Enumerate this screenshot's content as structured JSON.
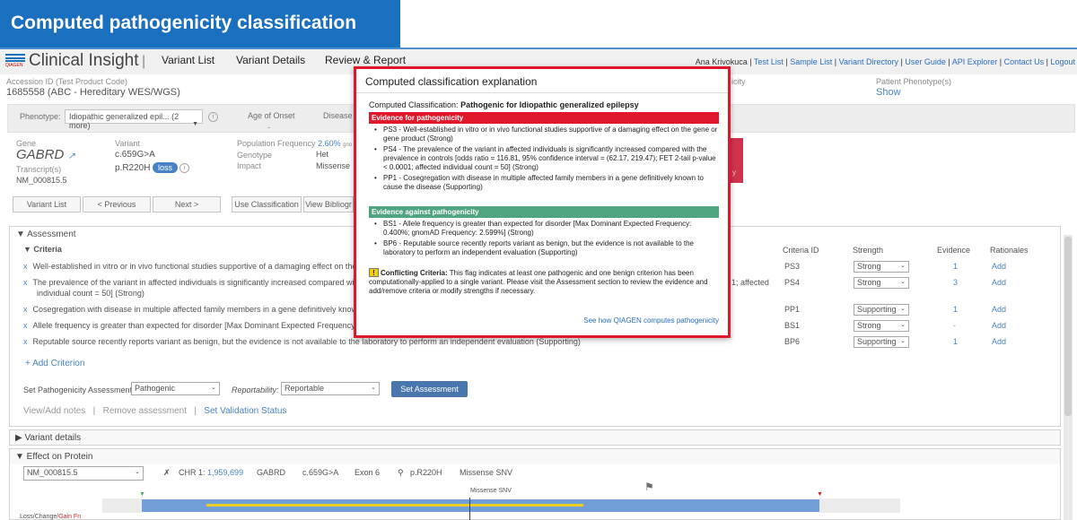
{
  "banner": {
    "title": "Computed pathogenicity classification"
  },
  "app": {
    "brand_prefix": "QIAGEN",
    "brand": "Clinical Insight",
    "separator": "|",
    "nav": [
      "Variant List",
      "Variant Details",
      "Review & Report"
    ],
    "user_links": [
      "Ana Krivokuca",
      "Test List",
      "Sample List",
      "Variant Directory",
      "User Guide",
      "API Explorer",
      "Contact Us",
      "Logout"
    ]
  },
  "accession": {
    "label": "Accession ID (Test Product Code)",
    "value": "1685558  (ABC - Hereditary WES/WGS)"
  },
  "patient_phenotype": {
    "label": "Patient Phenotype(s)",
    "value": "Show",
    "left_fragment": "icity"
  },
  "phenotype_row": {
    "label": "Phenotype:",
    "select_value": "Idiopathic generalized epil... (2 more)",
    "age_label": "Age of Onset",
    "age_value": "-",
    "disease_label": "Disease"
  },
  "gene_area": {
    "gene_label": "Gene",
    "gene": "GABRD",
    "transcript_label": "Transcript(s)",
    "transcript": "NM_000815.5",
    "variant_label": "Variant",
    "variant_c": "c.659G>A",
    "variant_p": "p.R220H",
    "loss_badge": "loss",
    "pop_freq_label": "Population Frequency",
    "pop_freq_value": "2.60%",
    "pop_freq_suffix": "gno",
    "genotype_label": "Genotype",
    "genotype_value": "Het",
    "impact_label": "Impact",
    "impact_value": "Missense",
    "red_box_text": "y"
  },
  "buttons": {
    "variant_list": "Variant List",
    "previous": "< Previous",
    "next": "Next >",
    "use_classification": "Use Classification",
    "view_biblio": "View Bibliogr"
  },
  "assessment": {
    "header": "▼ Assessment",
    "criteria_header": "▼ Criteria",
    "columns": {
      "criteria_id": "Criteria ID",
      "strength": "Strength",
      "evidence": "Evidence",
      "rationales": "Rationales"
    },
    "rows": [
      {
        "text": "Well-established in vitro or in vivo functional studies supportive of a damaging effect on the gen",
        "id": "PS3",
        "strength": "Strong",
        "evidence": "1",
        "rationale": "Add"
      },
      {
        "text": "The prevalence of the variant in affected individuals is significantly increased compared with th",
        "text2": "individual count = 50] (Strong)",
        "tail": "1; affected",
        "id": "PS4",
        "strength": "Strong",
        "evidence": "3",
        "rationale": "Add"
      },
      {
        "text": "Cosegregation with disease in multiple affected family members in a gene definitively known to",
        "id": "PP1",
        "strength": "Supporting",
        "evidence": "1",
        "rationale": "Add"
      },
      {
        "text": "Allele frequency is greater than expected for disorder [Max Dominant Expected Frequency: 0.4",
        "id": "BS1",
        "strength": "Strong",
        "evidence": "-",
        "rationale": "Add"
      },
      {
        "text": "Reputable source recently reports variant as benign, but the evidence is not available to the laboratory to perform an independent evaluation (Supporting)",
        "id": "BP6",
        "strength": "Supporting",
        "evidence": "1",
        "rationale": "Add"
      }
    ],
    "add_criterion": "+ Add Criterion",
    "set_path_label": "Set Pathogenicity Assessment:",
    "set_path_value": "Pathogenic",
    "reportability_label": "Reportability:",
    "reportability_value": "Reportable",
    "set_assessment_button": "Set Assessment",
    "view_add_notes": "View/Add notes",
    "remove_assessment": "Remove assessment",
    "link_separator": "|",
    "set_validation": "Set Validation Status"
  },
  "variant_details": {
    "header": "▶ Variant details"
  },
  "effect": {
    "header": "▼ Effect on Protein",
    "transcript": "NM_000815.5",
    "chr_label": "CHR 1:",
    "chr_pos": "1,959,699",
    "gene": "GABRD",
    "cdna": "c.659G>A",
    "exon": "Exon 6",
    "protein": "p.R220H",
    "type": "Missense SNV",
    "marker_label": "Missense SNV",
    "bottom_label": "Loss/Change/",
    "bottom_link": "Gain Fn"
  },
  "modal": {
    "title": "Computed classification explanation",
    "computed_label": "Computed Classification:",
    "computed_value": "Pathogenic for Idiopathic generalized epilepsy",
    "evidence_for_header": "Evidence for pathogenicity",
    "evidence_for": [
      "PS3 - Well-established in vitro or in vivo functional studies supportive of a damaging effect on the gene or gene product (Strong)",
      "PS4 - The prevalence of the variant in affected individuals is significantly increased compared with the prevalence in controls [odds ratio = 116.81, 95% confidence interval = (62.17, 219.47); FET 2-tail p-value < 0.0001; affected individual count = 50] (Strong)",
      "PP1 - Cosegregation with disease in multiple affected family members in a gene definitively known to cause the disease (Supporting)"
    ],
    "evidence_against_header": "Evidence against pathogenicity",
    "evidence_against": [
      "BS1 - Allele frequency is greater than expected for disorder [Max Dominant Expected Frequency: 0.400%; gnomAD Frequency: 2.599%] (Strong)",
      "BP6 - Reputable source recently reports variant as benign, but the evidence is not available to the laboratory to perform an independent evaluation (Supporting)"
    ],
    "conflict_icon": "!",
    "conflict_title": "Conflicting Criteria:",
    "conflict_text": "This flag indicates at least one pathogenic and one benign criterion has been computationally-applied to a single variant. Please visit the Assessment section to review the evidence and add/remove criteria or modify strengths if necessary.",
    "link": "See how QIAGEN computes pathogenicity"
  },
  "colors": {
    "banner": "#1a6fbf",
    "modal_border": "#e0182c",
    "evidence_for": "#e0182c",
    "evidence_against": "#4fa57f",
    "accent": "#2a6ebb"
  }
}
